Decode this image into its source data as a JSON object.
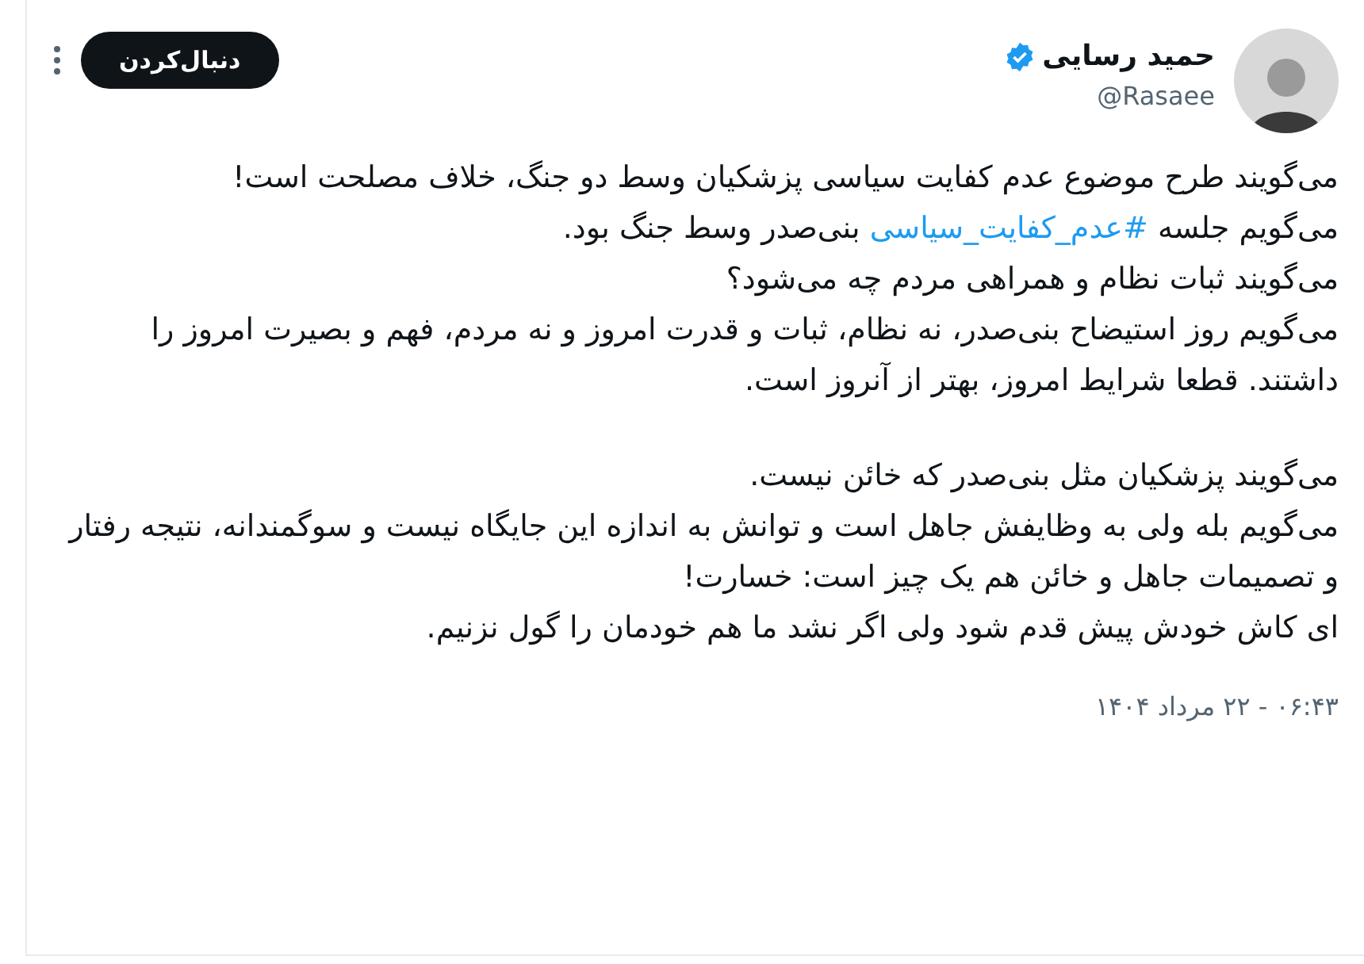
{
  "author": {
    "name": "حمید رسایی",
    "verified": true,
    "handle": "@Rasaee"
  },
  "follow_button": "دنبال‌کردن",
  "body": [
    [
      [
        {
          "kind": "text",
          "text": "می‌گویند طرح موضوع عدم کفایت سیاسی پزشکیان وسط دو جنگ، خلاف مصلحت است!"
        }
      ],
      [
        {
          "kind": "text",
          "text": "می‌گویم جلسه "
        },
        {
          "kind": "hashtag",
          "text": "#عدم_کفایت_سیاسی"
        },
        {
          "kind": "text",
          "text": " بنی‌صدر وسط جنگ بود."
        }
      ],
      [
        {
          "kind": "text",
          "text": "می‌گویند ثبات نظام و همراهی مردم چه می‌شود؟"
        }
      ],
      [
        {
          "kind": "text",
          "text": "می‌گویم روز  استیضاح بنی‌صدر، نه نظام، ثبات و قدرت امروز و نه مردم، فهم و بصیرت امروز را داشتند. قطعا شرایط امروز، بهتر از آنروز است."
        }
      ]
    ],
    [
      [
        {
          "kind": "text",
          "text": "می‌گویند پزشکیان مثل بنی‌صدر که خائن نیست."
        }
      ],
      [
        {
          "kind": "text",
          "text": "می‌گویم بله ولی به وظایفش جاهل است و توانش به اندازه این جایگاه نیست و سوگمندانه، نتیجه رفتار و تصمیمات جاهل و خائن هم یک چیز است: خسارت!"
        }
      ],
      [
        {
          "kind": "text",
          "text": "ای کاش خودش پیش قدم شود ولی اگر نشد ما هم خودمان را گول نزنیم."
        }
      ]
    ]
  ],
  "timestamp": "۰۶:۴۳ - ۲۲ مرداد ۱۴۰۴"
}
